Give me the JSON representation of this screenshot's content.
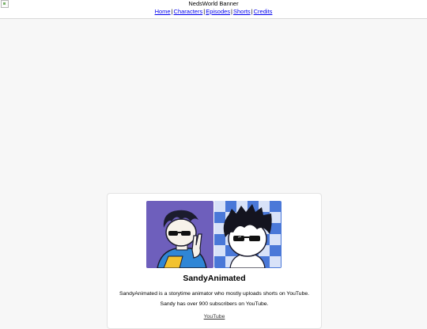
{
  "header": {
    "banner_alt": "NedsWorld Banner",
    "separator": "|",
    "nav": [
      {
        "label": "Home"
      },
      {
        "label": "Characters"
      },
      {
        "label": "Episodes"
      },
      {
        "label": "Shorts"
      },
      {
        "label": "Credits"
      }
    ]
  },
  "profile": {
    "name": "SandyAnimated",
    "description_1": "SandyAnimated is a storytime animator who mostly uploads shorts on YouTube.",
    "description_2": "Sandy has over 900 subscribers on YouTube.",
    "link_label": "YouTube"
  },
  "colors": {
    "avatar1_bg": "#6b5bb8",
    "avatar2_bg": "#4a78d8",
    "link": "#0000ee"
  }
}
